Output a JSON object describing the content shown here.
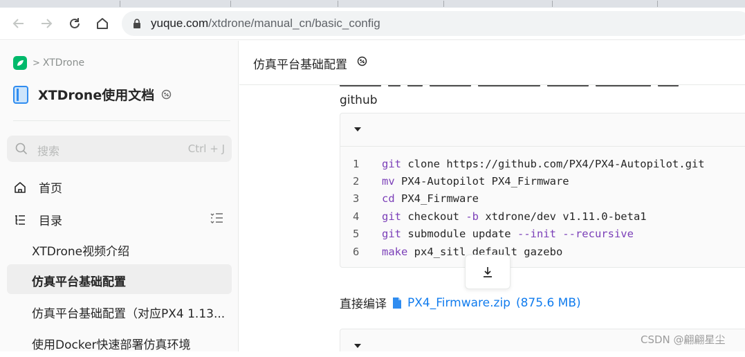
{
  "browser": {
    "url_host": "yuque.com",
    "url_path": "/xtdrone/manual_cn/basic_config"
  },
  "sidebar": {
    "breadcrumb": "XTDrone",
    "book_title": "XTDrone使用文档",
    "search_placeholder": "搜索",
    "search_shortcut": "Ctrl + J",
    "home_label": "首页",
    "toc_label": "目录",
    "toc_items": [
      {
        "label": "XTDrone视频介绍",
        "active": false
      },
      {
        "label": "仿真平台基础配置",
        "active": true
      },
      {
        "label": "仿真平台基础配置（对应PX4 1.13...",
        "active": false
      },
      {
        "label": "使用Docker快速部署仿真环境",
        "active": false
      }
    ]
  },
  "doc": {
    "header_title": "仿真平台基础配置",
    "para_github": "github",
    "code_lines": [
      {
        "n": "1",
        "cmd": "git",
        "rest": " clone https://github.com/PX4/PX4-Autopilot.git"
      },
      {
        "n": "2",
        "cmd": "mv",
        "rest": " PX4-Autopilot PX4_Firmware"
      },
      {
        "n": "3",
        "cmd": "cd",
        "rest": " PX4_Firmware"
      },
      {
        "n": "4",
        "cmd": "git",
        "rest": " checkout ",
        "flag": "-b",
        "rest2": " xtdrone/dev v1.11.0-beta1"
      },
      {
        "n": "5",
        "cmd": "git",
        "rest": " submodule update ",
        "flag": "--init --recursive",
        "rest2": ""
      },
      {
        "n": "6",
        "cmd": "make",
        "rest": " px4_sitl default gazebo"
      }
    ],
    "compile_label": "直接编译",
    "file_name": "PX4_Firmware.zip",
    "file_size": "(875.6 MB)"
  },
  "watermark": "CSDN @翩翩星尘",
  "colors": {
    "link": "#117cee",
    "keyword": "#7b3fb8",
    "sidebar_bg": "#fafafa"
  }
}
